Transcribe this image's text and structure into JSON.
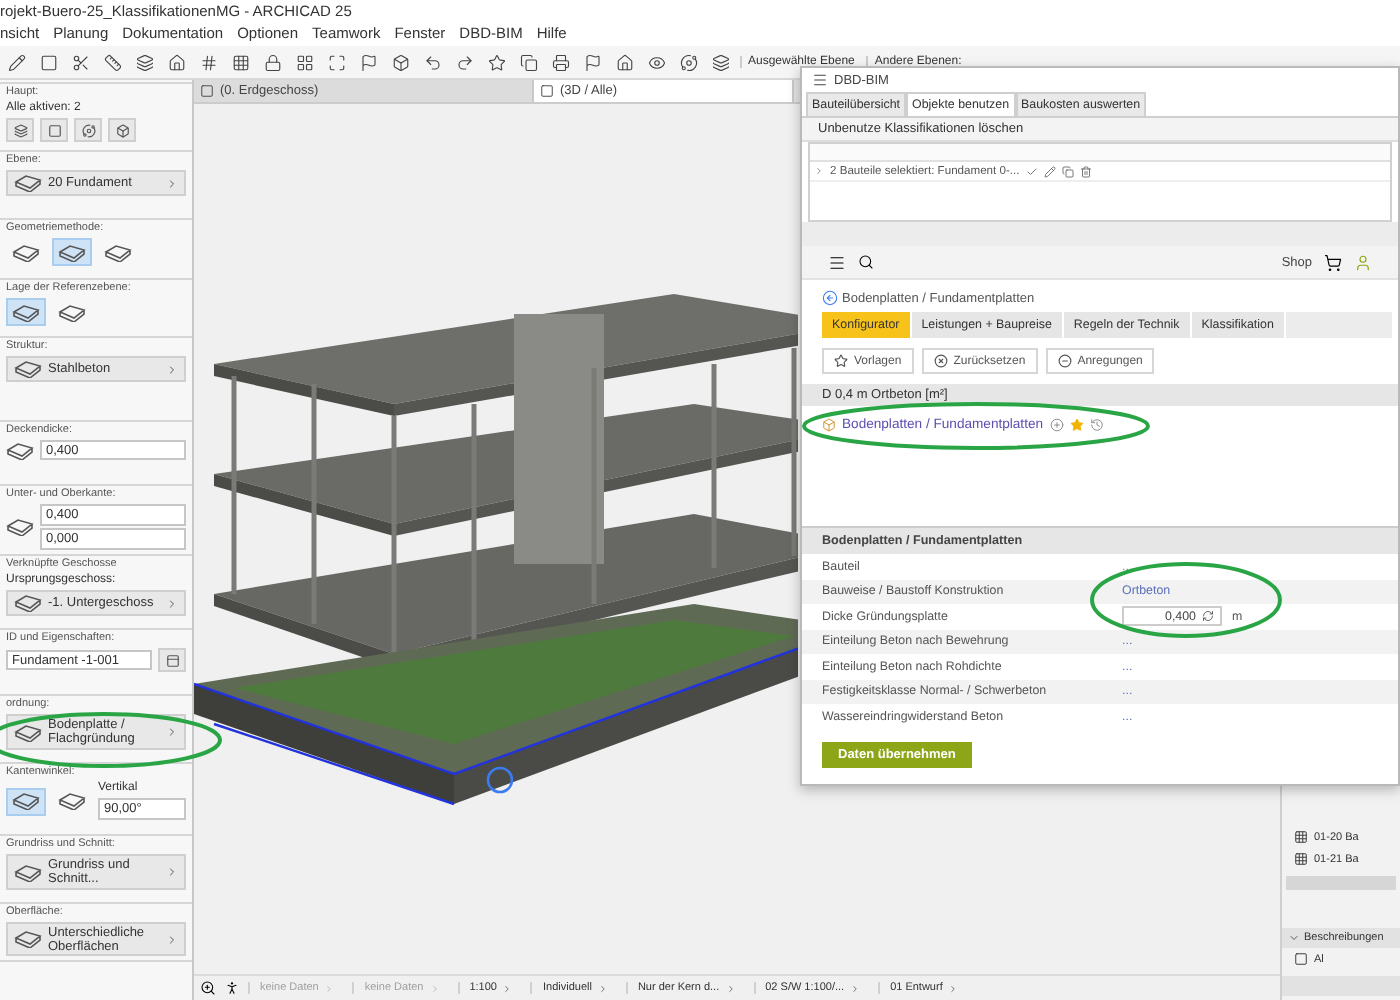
{
  "window": {
    "title": "rojekt-Buero-25_KlassifikationenMG - ARCHICAD 25"
  },
  "menu": [
    "nsicht",
    "Planung",
    "Dokumentation",
    "Optionen",
    "Teamwork",
    "Fenster",
    "DBD-BIM",
    "Hilfe"
  ],
  "toolbar": {
    "layer_selected": "Ausgewählte Ebene",
    "layer_other": "Andere Ebenen:"
  },
  "view_tabs": [
    {
      "label": "(0. Erdgeschoss)",
      "selected": false
    },
    {
      "label": "(3D / Alle)",
      "selected": true
    }
  ],
  "info_box": [
    {
      "kind": "header",
      "label": "Haupt:",
      "text": "Alle aktiven: 2"
    },
    {
      "kind": "select",
      "label": "Ebene:",
      "value": "20 Fundament"
    },
    {
      "kind": "options",
      "label": "Geometriemethode:",
      "options": [
        {
          "selected": false
        },
        {
          "selected": true
        },
        {
          "selected": false
        }
      ]
    },
    {
      "kind": "options",
      "label": "Lage der Referenzebene:",
      "options": [
        {
          "selected": true
        },
        {
          "selected": false
        }
      ]
    },
    {
      "kind": "select",
      "label": "Struktur:",
      "value": "Stahlbeton"
    },
    {
      "kind": "field",
      "label": "Deckendicke:",
      "value": "0,400"
    },
    {
      "kind": "fields",
      "label": "Unter- und Oberkante:",
      "values": [
        "0,400",
        "0,000"
      ]
    },
    {
      "kind": "storey",
      "label": "Verknüpfte Geschosse",
      "sublabel": "Ursprungsgeschoss:",
      "value": "-1. Untergeschoss"
    },
    {
      "kind": "idfield",
      "label": "ID und Eigenschaften:",
      "value": "Fundament -1-001"
    },
    {
      "kind": "select",
      "label": "ordnung:",
      "value": "Bodenplatte / Flachgründung"
    },
    {
      "kind": "angle",
      "label": "Kantenwinkel:",
      "options": [
        {
          "selected": true
        },
        {
          "selected": false
        }
      ],
      "caption": "Vertikal",
      "value": "90,00°"
    },
    {
      "kind": "select",
      "label": "Grundriss und Schnitt:",
      "value": "Grundriss und Schnitt..."
    },
    {
      "kind": "select",
      "label": "Oberfläche:",
      "value": "Unterschiedliche Oberflächen"
    }
  ],
  "dbd_window": {
    "title": "DBD-BIM",
    "tabs": [
      {
        "label": "Bauteilübersicht",
        "selected": false
      },
      {
        "label": "Objekte benutzen",
        "selected": true
      },
      {
        "label": "Baukosten auswerten",
        "selected": false
      }
    ],
    "action": "Unbenutze Klassifikationen löschen",
    "selection_row": "2 Bauteile selektiert: Fundament 0-...",
    "shop": "Shop",
    "breadcrumb": "Bodenplatten / Fundamentplatten",
    "web_tabs": [
      {
        "label": "Konfigurator",
        "selected": true
      },
      {
        "label": "Leistungen + Baupreise",
        "selected": false
      },
      {
        "label": "Regeln der Technik",
        "selected": false
      },
      {
        "label": "Klassifikation",
        "selected": false
      }
    ],
    "buttons": [
      "Vorlagen",
      "Zurücksetzen",
      "Anregungen"
    ],
    "item_header": "D 0,4 m Ortbeton [m²]",
    "item_link": "Bodenplatten / Fundamentplatten",
    "properties_title": "Bodenplatten / Fundamentplatten",
    "properties": [
      {
        "label": "Bauteil",
        "kind": "plain",
        "value": "..."
      },
      {
        "label": "Bauweise / Baustoff Konstruktion",
        "kind": "link",
        "value": "Ortbeton"
      },
      {
        "label": "Dicke Gründungsplatte",
        "kind": "input",
        "value": "0,400",
        "unit": "m"
      },
      {
        "label": "Einteilung Beton nach Bewehrung",
        "kind": "link",
        "value": "..."
      },
      {
        "label": "Einteilung Beton nach Rohdichte",
        "kind": "link",
        "value": "..."
      },
      {
        "label": "Festigkeitsklasse Normal- / Schwerbeton",
        "kind": "link",
        "value": "..."
      },
      {
        "label": "Wassereindringwiderstand Beton",
        "kind": "link",
        "value": "..."
      }
    ],
    "submit": "Daten übernehmen"
  },
  "navigator": {
    "items": [
      "01-20 Ba",
      "01-21 Ba"
    ],
    "section": "Beschreibungen",
    "section_item": "Al"
  },
  "status_bar": [
    {
      "text": "keine Daten",
      "disabled": true
    },
    {
      "text": "keine Daten",
      "disabled": true
    },
    {
      "text": "1:100",
      "disabled": false
    },
    {
      "text": "Individuell",
      "disabled": false
    },
    {
      "text": "Nur der Kern d...",
      "disabled": false
    },
    {
      "text": "02 S/W 1:100/...",
      "disabled": false
    },
    {
      "text": "01 Entwurf",
      "disabled": false
    }
  ]
}
